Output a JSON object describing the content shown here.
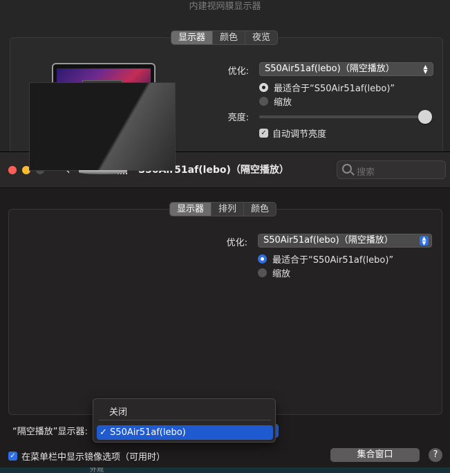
{
  "back_window": {
    "title": "内建视网膜显示器",
    "tabs": [
      "显示器",
      "颜色",
      "夜览"
    ],
    "active_tab": "显示器",
    "optimize_label": "优化:",
    "optimize_value": "S50Air51af(lebo)（隔空播放）",
    "radio_best": "最适合于“S50Air51af(lebo)”",
    "radio_scaled": "缩放",
    "brightness_label": "亮度:",
    "brightness_level": 1.0,
    "auto_brightness": "自动调节亮度"
  },
  "front_window": {
    "title": "S50Air51af(lebo)（隔空播放）",
    "search_placeholder": "搜索",
    "tabs": [
      "显示器",
      "排列",
      "颜色"
    ],
    "active_tab": "显示器",
    "optimize_label": "优化:",
    "optimize_value": "S50Air51af(lebo)（隔空播放）",
    "radio_best": "最适合于“S50Air51af(lebo)”",
    "radio_scaled": "缩放",
    "airplay_display_label": "“隔空播放”显示器:",
    "dropdown": {
      "items": [
        "关闭",
        "S50Air51af(lebo)"
      ],
      "selected": "S50Air51af(lebo)",
      "check": "✓"
    },
    "menu_bar_checkbox": "在菜单栏中显示镜像选项（可用时）",
    "gather_windows_button": "集合窗口",
    "help_button": "?",
    "bottom_cutoff_text": "外观"
  },
  "colors": {
    "accent_blue": "#2e6ee6",
    "close": "#ff5f57",
    "minimize": "#febc2e",
    "zoom_inactive": "#4d4d4d"
  },
  "icons": [
    "chevron-left-icon",
    "chevron-right-icon",
    "grid-icon",
    "search-icon",
    "checkmark-icon",
    "popup-arrows-icon"
  ]
}
